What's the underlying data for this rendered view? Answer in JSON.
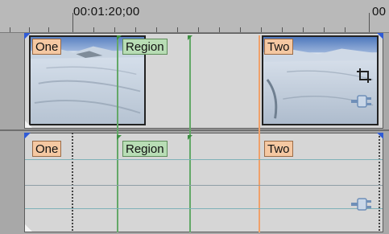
{
  "ruler": {
    "timecode_main": "00:01:20;00",
    "timecode_right": "00"
  },
  "track1": {
    "markers": [
      {
        "label": "One",
        "color": "orange"
      },
      {
        "label": "Region",
        "color": "green"
      },
      {
        "label": "Two",
        "color": "orange"
      }
    ]
  },
  "track2": {
    "markers": [
      {
        "label": "One",
        "color": "orange"
      },
      {
        "label": "Region",
        "color": "green"
      },
      {
        "label": "Two",
        "color": "orange"
      }
    ]
  },
  "colors": {
    "marker_orange": "#f5c8a2",
    "marker_green": "#b8ddb5",
    "region_line": "#63a867",
    "cursor_line": "#f0a06a",
    "envelope_line": "#7fb1b8"
  },
  "icons": {
    "crop": "crop-icon",
    "envelope": "event-fx-icon"
  }
}
